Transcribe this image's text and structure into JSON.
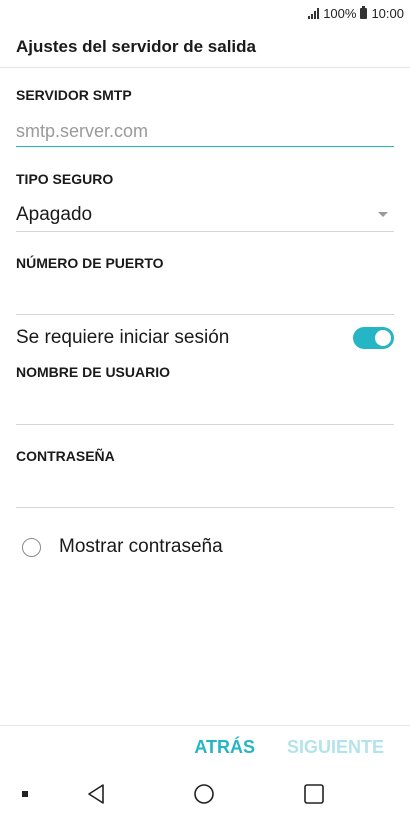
{
  "status_bar": {
    "battery": "100%",
    "time": "10:00",
    "icons": [
      "signal-icon",
      "battery-icon"
    ]
  },
  "header": {
    "title": "Ajustes del servidor de salida"
  },
  "form": {
    "smtp_label": "SERVIDOR SMTP",
    "smtp_placeholder": "smtp.server.com",
    "security_label": "TIPO SEGURO",
    "security_value": "Apagado",
    "port_label": "NÚMERO DE PUERTO",
    "port_value": "",
    "login_required_label": "Se requiere iniciar sesión",
    "login_required": true,
    "username_label": "NOMBRE DE USUARIO",
    "username_value": "",
    "password_label": "CONTRASEÑA",
    "password_value": "",
    "show_password_label": "Mostrar contraseña",
    "show_password": false
  },
  "footer": {
    "back_label": "ATRÁS",
    "next_label": "SIGUIENTE"
  },
  "nav_bar": {
    "icons": [
      "notification-dot-icon",
      "back-icon",
      "home-icon",
      "recents-icon"
    ]
  },
  "colors": {
    "accent": "#26b5c4",
    "accent_disabled": "#b3e4ea",
    "divider": "#d6d6d6"
  }
}
